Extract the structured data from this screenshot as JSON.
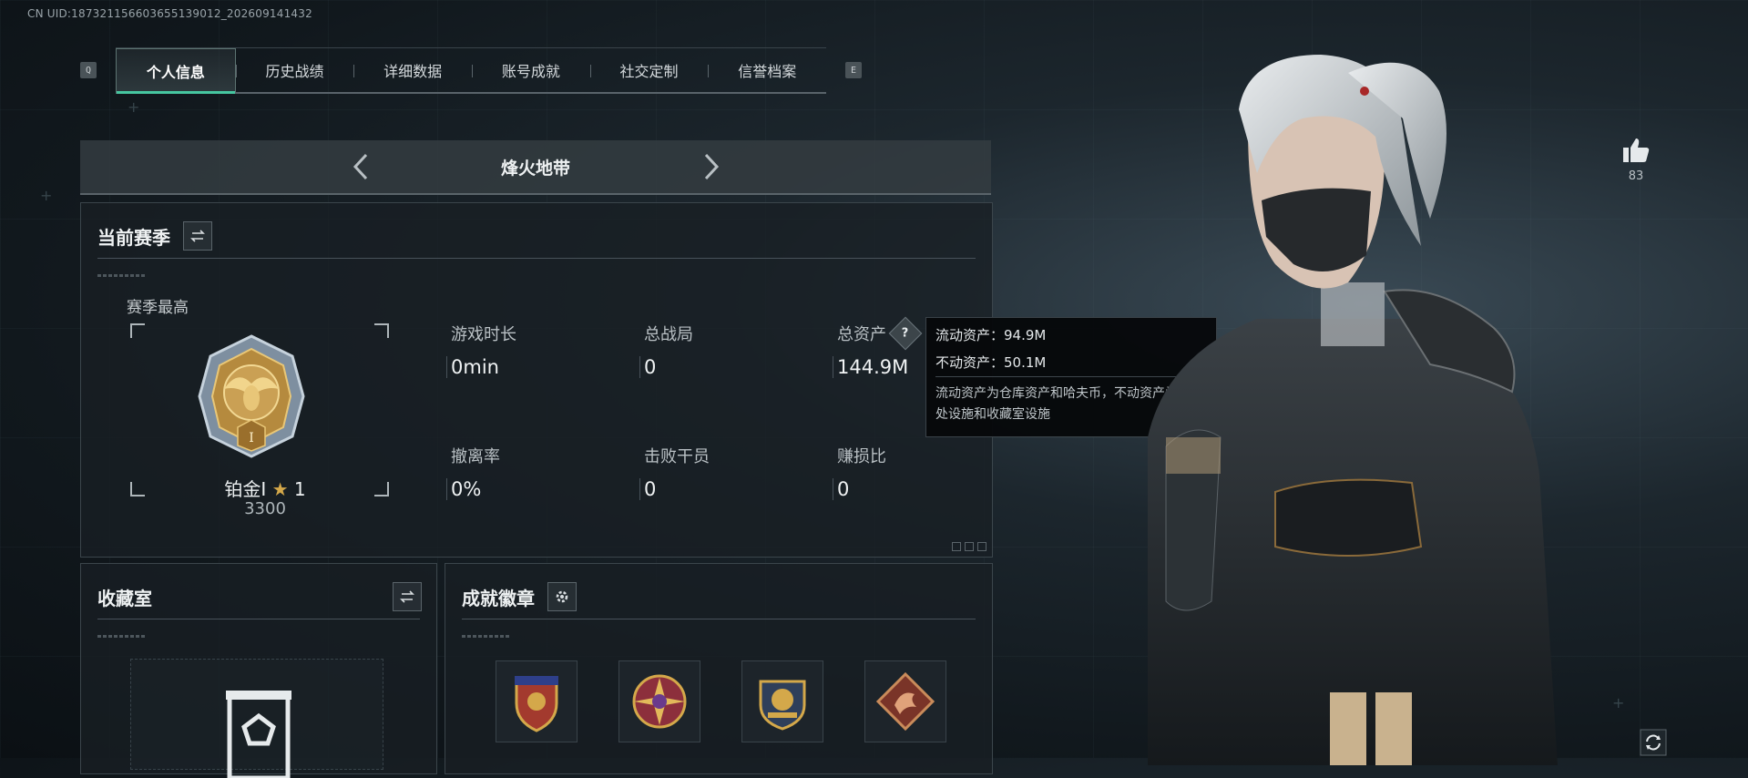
{
  "uid_text": "CN UID:187321156603655139012_202609141432",
  "keys": {
    "prev": "Q",
    "next": "E"
  },
  "tabs": [
    {
      "label": "个人信息",
      "active": true
    },
    {
      "label": "历史战绩",
      "active": false
    },
    {
      "label": "详细数据",
      "active": false
    },
    {
      "label": "账号成就",
      "active": false
    },
    {
      "label": "社交定制",
      "active": false
    },
    {
      "label": "信誉档案",
      "active": false
    }
  ],
  "mode": {
    "title": "烽火地带"
  },
  "season": {
    "title": "当前赛季",
    "highest_label": "赛季最高",
    "rank_name": "铂金I",
    "rank_stars": "1",
    "rank_score": "3300",
    "stats": [
      {
        "label": "游戏时长",
        "value": "0min"
      },
      {
        "label": "总战局",
        "value": "0"
      },
      {
        "label": "总资产",
        "value": "144.9M"
      },
      {
        "label": "撤离率",
        "value": "0%"
      },
      {
        "label": "击败干员",
        "value": "0"
      },
      {
        "label": "赚损比",
        "value": "0"
      }
    ]
  },
  "tooltip": {
    "liquid": "流动资产：94.9M",
    "fixed": "不动资产：50.1M",
    "desc": "流动资产为仓库资产和哈夫币，不动资产为特勤处设施和收藏室设施"
  },
  "collection": {
    "title": "收藏室"
  },
  "badges": {
    "title": "成就徽章"
  },
  "likes": {
    "count": "83"
  },
  "colors": {
    "accent": "#46c6a0",
    "gold": "#d4a84a"
  }
}
